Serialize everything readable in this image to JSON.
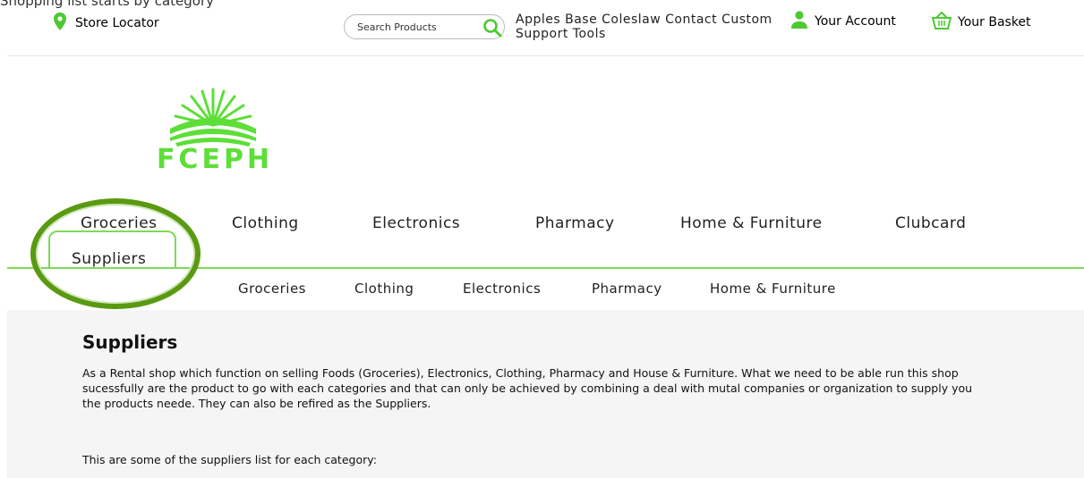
{
  "cropped_top_text": "Shopping list starts by category",
  "header": {
    "store_locator": "Store Locator",
    "search_placeholder": "Search Products",
    "quick_links": "Apples Base Coleslaw Contact Custom Support Tools",
    "account": "Your Account",
    "basket": "Your Basket"
  },
  "logo": {
    "text": "FCEPH"
  },
  "nav": {
    "items": [
      "Groceries",
      "Clothing",
      "Electronics",
      "Pharmacy",
      "Home & Furniture",
      "Clubcard"
    ],
    "active_tab": "Suppliers"
  },
  "subnav": {
    "items": [
      "Groceries",
      "Clothing",
      "Electronics",
      "Pharmacy",
      "Home & Furniture"
    ]
  },
  "main": {
    "title": "Suppliers",
    "paragraph1": "As a Rental shop which function on selling Foods (Groceries), Electronics, Clothing, Pharmacy and House & Furniture. What we need to be able run this shop sucessfully are the product to go with each categories and that can only be achieved by combining a deal with mutal companies or organization to supply you the products neede. They can also be refired as the Suppliers.",
    "paragraph2": "This are some of the suppliers list for each category:"
  },
  "colors": {
    "brand_green": "#7ed957",
    "icon_green": "#4cc932",
    "annotation": "#5a9a12",
    "content_bg": "#f5f5f5"
  }
}
